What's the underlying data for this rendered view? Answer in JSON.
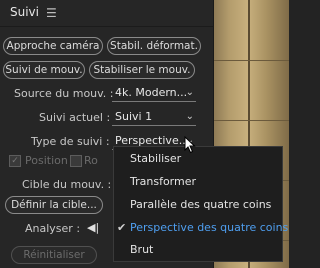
{
  "header": {
    "title": "Suivi",
    "menu_icon": "hamburger-icon"
  },
  "buttons": {
    "approche": "Approche caméra",
    "stabil": "Stabil. déformat.",
    "suivi_mouv": "Suivi de mouv.",
    "stabiliser_mouv": "Stabiliser le mouv.",
    "definir": "Définir la cible...",
    "reinitialiser": "Réinitialiser"
  },
  "fields": {
    "source_label": "Source du mouv. :",
    "source_value": "4k. Modern...",
    "suivi_actuel_label": "Suivi actuel :",
    "suivi_actuel_value": "Suivi 1",
    "type_label": "Type de suivi :",
    "type_value": "Perspective...",
    "position_label": "Position",
    "rotation_label": "Ro",
    "cible_label": "Cible du mouv. :",
    "analyser_label": "Analyser :",
    "analyser_icon": "step-back-icon"
  },
  "popup": {
    "items": [
      {
        "label": "Stabiliser",
        "selected": false
      },
      {
        "label": "Transformer",
        "selected": false
      },
      {
        "label": "Parallèle des quatre coins",
        "selected": false
      },
      {
        "label": "Perspective des quatre coins",
        "selected": true
      },
      {
        "label": "Brut",
        "selected": false
      }
    ]
  },
  "colors": {
    "selected_text": "#4f9ff0",
    "panel_bg": "#262626",
    "popup_bg": "#1e1e1e"
  }
}
